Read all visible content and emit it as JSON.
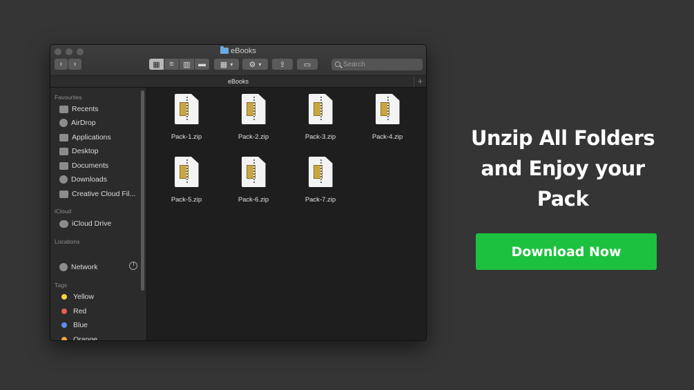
{
  "window": {
    "title": "eBooks",
    "path_title": "eBooks",
    "search_placeholder": "Search",
    "new_tab_label": "+"
  },
  "sidebar": {
    "favourites_header": "Favourites",
    "favourites": [
      {
        "label": "Recents",
        "icon": "recents-icon"
      },
      {
        "label": "AirDrop",
        "icon": "airdrop-icon"
      },
      {
        "label": "Applications",
        "icon": "applications-icon"
      },
      {
        "label": "Desktop",
        "icon": "desktop-icon"
      },
      {
        "label": "Documents",
        "icon": "documents-icon"
      },
      {
        "label": "Downloads",
        "icon": "downloads-icon"
      },
      {
        "label": "Creative Cloud Fil...",
        "icon": "folder-icon"
      }
    ],
    "icloud_header": "iCloud",
    "icloud": [
      {
        "label": "iCloud Drive",
        "icon": "cloud-icon"
      }
    ],
    "locations_header": "Locations",
    "locations": [
      {
        "label": "Network",
        "icon": "network-icon"
      }
    ],
    "tags_header": "Tags",
    "tags": [
      {
        "label": "Yellow",
        "color": "#f5d442"
      },
      {
        "label": "Red",
        "color": "#ea5e54"
      },
      {
        "label": "Blue",
        "color": "#5b8ef0"
      },
      {
        "label": "Orange",
        "color": "#f0a33a"
      }
    ]
  },
  "files": [
    {
      "name": "Pack-1.zip"
    },
    {
      "name": "Pack-2.zip"
    },
    {
      "name": "Pack-3.zip"
    },
    {
      "name": "Pack-4.zip"
    },
    {
      "name": "Pack-5.zip"
    },
    {
      "name": "Pack-6.zip"
    },
    {
      "name": "Pack-7.zip"
    }
  ],
  "promo": {
    "line1": "Unzip All Folders",
    "line2": "and Enjoy your",
    "line3": "Pack",
    "button_label": "Download Now",
    "button_color": "#1cc13f"
  }
}
